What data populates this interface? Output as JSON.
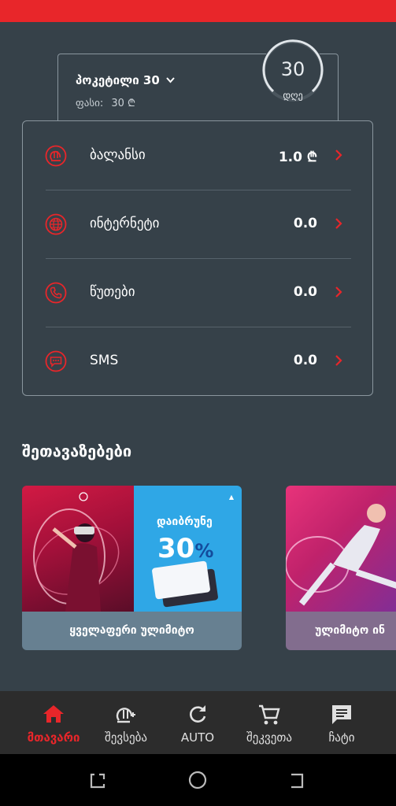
{
  "plan": {
    "name": "პოკეტილი 30",
    "price_label": "ფასი:",
    "price_value": "30 ₾",
    "days_value": "30",
    "days_label": "დღე"
  },
  "balances": [
    {
      "label": "ბალანსი",
      "value": "1.0 ₾",
      "icon": "lari-icon"
    },
    {
      "label": "ინტერნეტი",
      "value": "0.0",
      "icon": "globe-icon"
    },
    {
      "label": "წუთები",
      "value": "0.0",
      "icon": "phone-icon"
    },
    {
      "label": "SMS",
      "value": "0.0",
      "icon": "sms-icon"
    }
  ],
  "offers": {
    "title": "შეთავაზებები",
    "items": [
      {
        "caption": "ყველაფერი ულიმიტო",
        "promo_title": "დაიბრუნე",
        "promo_value": "30",
        "promo_unit": "%"
      },
      {
        "caption": "ულიმიტო ინ"
      }
    ]
  },
  "nav": {
    "items": [
      {
        "label": "მთავარი",
        "icon": "home-icon",
        "active": true
      },
      {
        "label": "შევსება",
        "icon": "topup-icon"
      },
      {
        "label": "AUTO",
        "icon": "refresh-icon"
      },
      {
        "label": "შეკვეთა",
        "icon": "cart-icon"
      },
      {
        "label": "ჩატი",
        "icon": "chat-icon"
      }
    ]
  },
  "colors": {
    "accent": "#e8262a",
    "background": "#364149",
    "nav_background": "#2c2c2c"
  }
}
